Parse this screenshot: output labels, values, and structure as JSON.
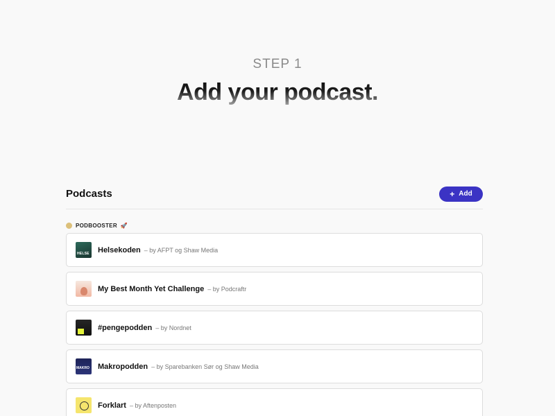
{
  "header": {
    "step": "STEP 1",
    "headline": "Add your podcast."
  },
  "panel": {
    "title": "Podcasts",
    "add_button": {
      "icon": "plus-icon",
      "label": "Add"
    },
    "accent_color": "#3b33c4"
  },
  "group": {
    "label": "PODBOOSTER",
    "icon": "rocket-icon",
    "dot_color": "#dcc07a"
  },
  "podcasts": [
    {
      "title": "Helsekoden",
      "by": "– by AFPT og Shaw Media"
    },
    {
      "title": "My Best Month Yet Challenge",
      "by": "– by Podcraftr"
    },
    {
      "title": "#pengepodden",
      "by": "– by Nordnet"
    },
    {
      "title": "Makropodden",
      "by": "– by Sparebanken Sør og Shaw Media"
    },
    {
      "title": "Forklart",
      "by": "– by Aftenposten"
    }
  ]
}
